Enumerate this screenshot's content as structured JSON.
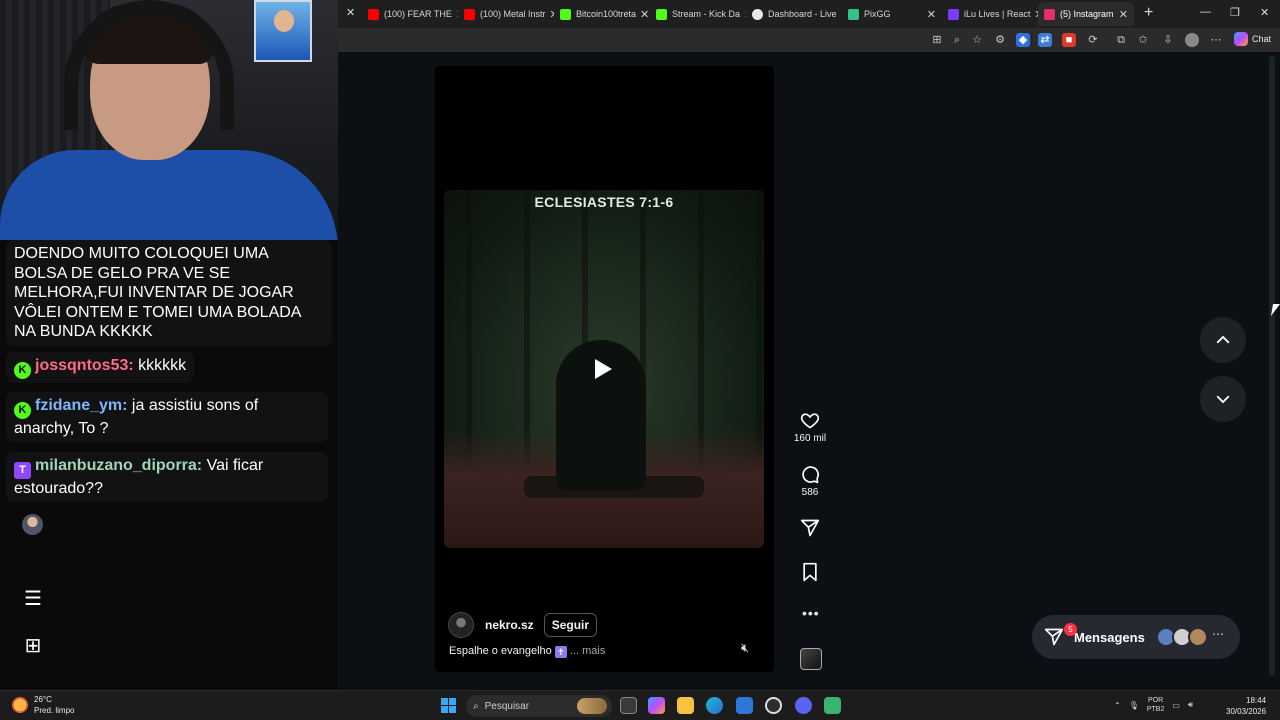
{
  "overlay": {
    "main_message": "DOENDO MUITO COLOQUEI UMA BOLSA DE GELO PRA VE SE MELHORA,FUI INVENTAR DE JOGAR VÔLEI ONTEM E TOMEI UMA BOLADA NA BUNDA KKKKK",
    "messages": [
      {
        "user": "jossqntos53:",
        "text": "kkkkkk",
        "user_color": "#ff6b8a",
        "badge": "kick"
      },
      {
        "user": "fzidane_ym:",
        "text": "ja assistiu sons of anarchy, To ?",
        "user_color": "#7db6ff",
        "badge": "kick"
      },
      {
        "user": "milanbuzano_diporra:",
        "text": "Vai ficar estourado??",
        "user_color": "#9fd6b8",
        "badge": "twitch"
      }
    ]
  },
  "browser": {
    "tabs": [
      {
        "title": "(100) FEAR THE",
        "color": "#ff0000"
      },
      {
        "title": "(100) Metal Instr",
        "color": "#ff0000"
      },
      {
        "title": "Bitcoin100treta",
        "color": "#53fc18"
      },
      {
        "title": "Stream - Kick Da",
        "color": "#53fc18"
      },
      {
        "title": "Dashboard - Live",
        "color": "#e8e8e8"
      },
      {
        "title": "PixGG",
        "color": "#35c28a"
      },
      {
        "title": "iLu Lives | React",
        "color": "#7a3cff"
      },
      {
        "title": "(5) Instagram",
        "color": "#e1306c",
        "active": true
      }
    ],
    "chat_label": "Chat"
  },
  "reel": {
    "video_title": "ECLESIASTES 7:1-6",
    "author": "nekro.sz",
    "follow_label": "Seguir",
    "caption": "Espalhe o evangelho",
    "caption_emoji": "✝",
    "more_label": "... mais",
    "likes": "160 mil",
    "comments": "586"
  },
  "messages_pill": {
    "label": "Mensagens",
    "badge": "5"
  },
  "taskbar": {
    "weather_temp": "26°C",
    "weather_desc": "Pred. limpo",
    "search_placeholder": "Pesquisar",
    "lang_1": "POR",
    "lang_2": "PTB2",
    "time": "18:44",
    "date": "30/03/2026"
  }
}
